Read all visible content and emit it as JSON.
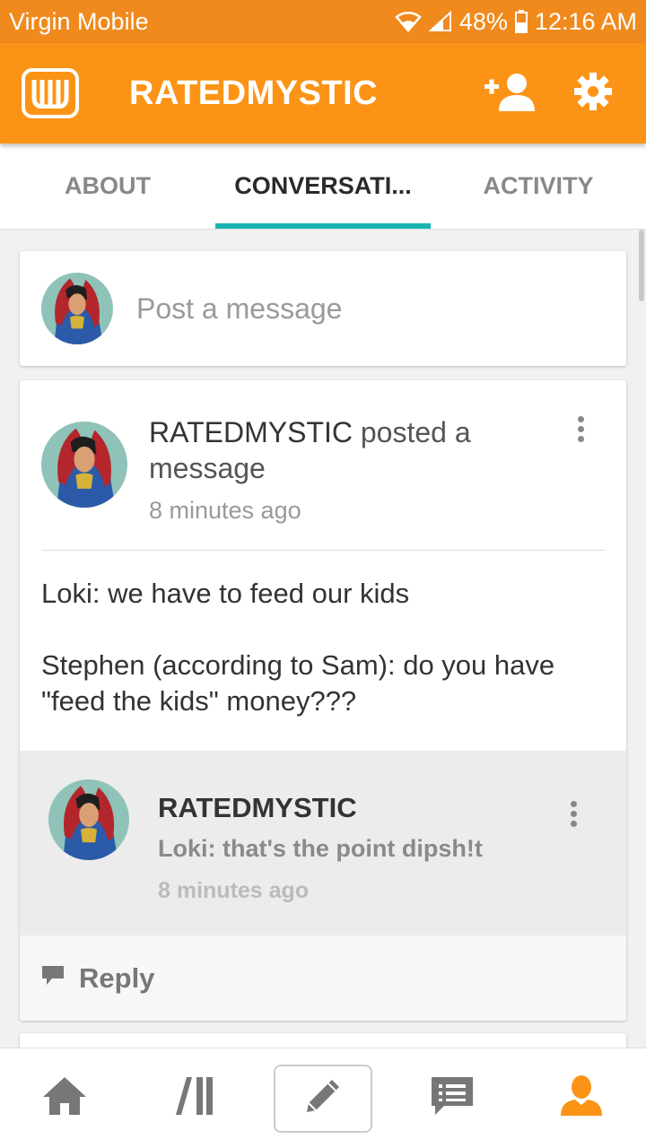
{
  "status_bar": {
    "carrier": "Virgin Mobile",
    "battery": "48%",
    "time": "12:16 AM"
  },
  "header": {
    "title": "RATEDMYSTIC"
  },
  "tabs": [
    {
      "label": "ABOUT",
      "active": false
    },
    {
      "label": "CONVERSATI...",
      "active": true
    },
    {
      "label": "ACTIVITY",
      "active": false
    }
  ],
  "post_box": {
    "placeholder": "Post a message"
  },
  "post": {
    "author": "RATEDMYSTIC",
    "action": "posted a message",
    "time": "8 minutes ago",
    "body": [
      "Loki: we have to feed our kids",
      "Stephen (according to Sam): do you have \"feed the kids\" money???"
    ]
  },
  "comment": {
    "author": "RATEDMYSTIC",
    "text": "Loki: that's the point dipsh!t",
    "time": "8 minutes ago"
  },
  "reply": {
    "label": "Reply"
  },
  "bottom_nav": [
    "home-icon",
    "library-icon",
    "pencil-icon",
    "messages-icon",
    "profile-icon"
  ],
  "colors": {
    "brand": "#fb9416",
    "status_bar": "#f08a1d",
    "tab_indicator": "#1ab3b3",
    "profile_active": "#fb9416"
  }
}
